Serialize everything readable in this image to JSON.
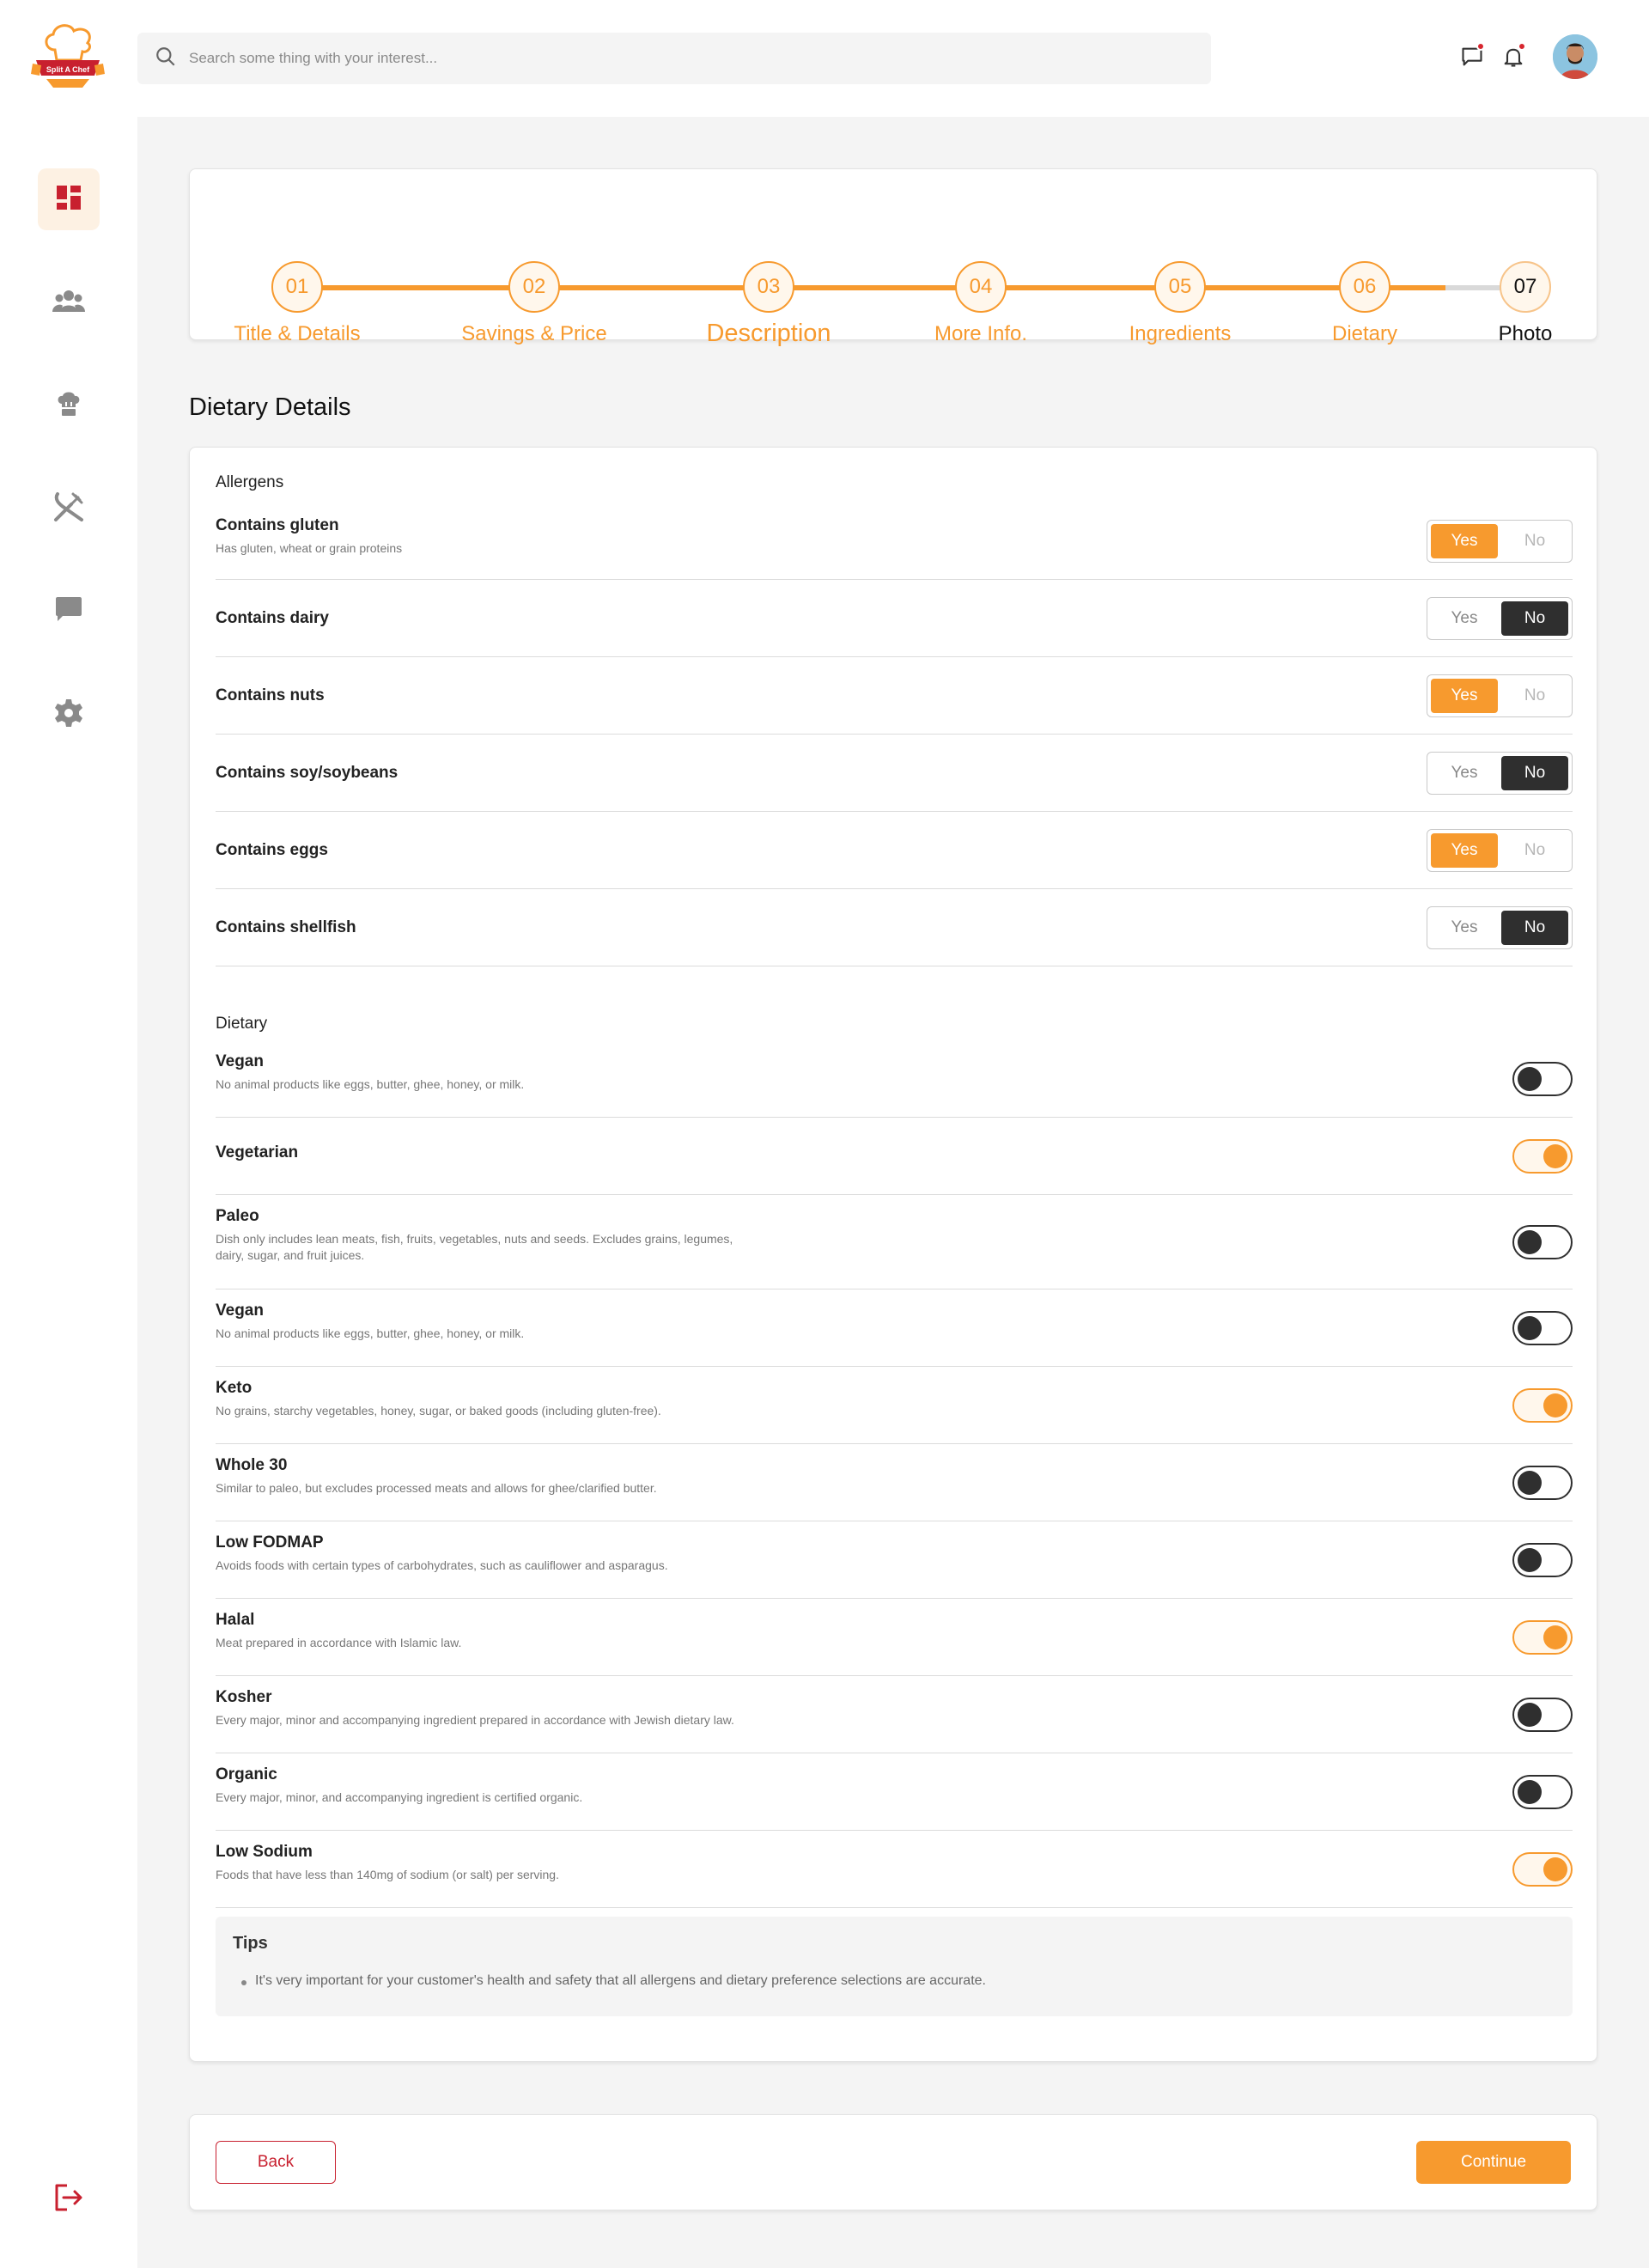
{
  "brand": {
    "logo_text": "Split A Chef"
  },
  "search": {
    "placeholder": "Search some thing with your interest..."
  },
  "header": {
    "messages_icon": "chat-icon",
    "notifications_icon": "bell-icon"
  },
  "sidebar": {
    "items": [
      {
        "icon": "dashboard-icon",
        "active": true
      },
      {
        "icon": "users-icon"
      },
      {
        "icon": "chef-hat-icon"
      },
      {
        "icon": "utensils-icon"
      },
      {
        "icon": "message-icon"
      },
      {
        "icon": "settings-icon"
      }
    ],
    "logout_icon": "logout-icon"
  },
  "stepper": {
    "steps": [
      {
        "num": "01",
        "label": "Title & Details"
      },
      {
        "num": "02",
        "label": "Savings & Price"
      },
      {
        "num": "03",
        "label": "Description"
      },
      {
        "num": "04",
        "label": "More Info."
      },
      {
        "num": "05",
        "label": "Ingredients"
      },
      {
        "num": "06",
        "label": "Dietary"
      },
      {
        "num": "07",
        "label": "Photo"
      }
    ],
    "progress": 0.96
  },
  "page": {
    "title": "Dietary Details"
  },
  "allergens": {
    "title": "Allergens",
    "yes_label": "Yes",
    "no_label": "No",
    "items": [
      {
        "title": "Contains gluten",
        "desc": "Has gluten, wheat or grain proteins",
        "value": "Yes"
      },
      {
        "title": "Contains dairy",
        "desc": "",
        "value": "No"
      },
      {
        "title": "Contains nuts",
        "desc": "",
        "value": "Yes"
      },
      {
        "title": "Contains soy/soybeans",
        "desc": "",
        "value": "No"
      },
      {
        "title": "Contains eggs",
        "desc": "",
        "value": "Yes"
      },
      {
        "title": "Contains shellfish",
        "desc": "",
        "value": "No"
      }
    ]
  },
  "dietary": {
    "title": "Dietary",
    "items": [
      {
        "title": "Vegan",
        "desc": "No animal products like eggs, butter, ghee, honey, or milk.",
        "on": false
      },
      {
        "title": "Vegetarian",
        "desc": "",
        "on": true
      },
      {
        "title": "Paleo",
        "desc": "Dish only includes lean meats, fish, fruits, vegetables, nuts and seeds. Excludes grains, legumes, dairy, sugar, and fruit juices.",
        "on": false
      },
      {
        "title": "Vegan",
        "desc": "No animal products like eggs, butter, ghee, honey, or milk.",
        "on": false
      },
      {
        "title": "Keto",
        "desc": "No grains, starchy vegetables, honey, sugar, or baked goods (including gluten-free).",
        "on": true
      },
      {
        "title": "Whole 30",
        "desc": "Similar to paleo, but excludes processed meats and allows for ghee/clarified butter.",
        "on": false
      },
      {
        "title": "Low FODMAP",
        "desc": "Avoids foods with certain types of carbohydrates, such as cauliflower and asparagus.",
        "on": false
      },
      {
        "title": "Halal",
        "desc": "Meat prepared in accordance with Islamic law.",
        "on": true
      },
      {
        "title": "Kosher",
        "desc": "Every major, minor and accompanying ingredient prepared in accordance with Jewish dietary law.",
        "on": false
      },
      {
        "title": "Organic",
        "desc": "Every major, minor, and accompanying ingredient is certified organic.",
        "on": false
      },
      {
        "title": "Low Sodium",
        "desc": "Foods that have less than 140mg of sodium (or salt) per serving.",
        "on": true
      }
    ]
  },
  "tips": {
    "title": "Tips",
    "items": [
      "It's very important for your customer's health and safety that all allergens and dietary preference selections are accurate."
    ]
  },
  "actions": {
    "back_label": "Back",
    "continue_label": "Continue"
  },
  "colors": {
    "accent": "#f79a2e",
    "brand_red": "#c8202f",
    "dark": "#2f2f2f"
  }
}
